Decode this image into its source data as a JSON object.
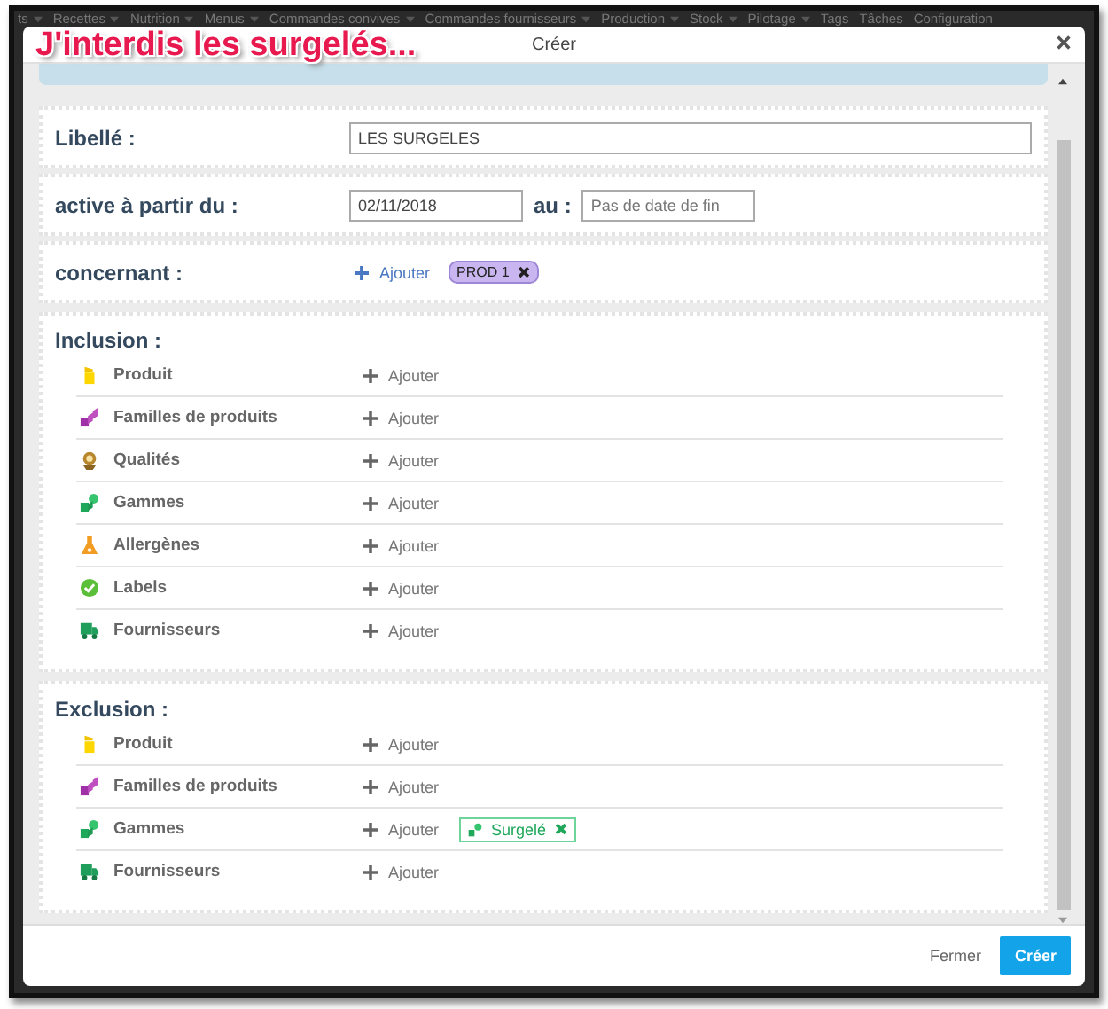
{
  "background_nav": [
    {
      "label": "ts",
      "caret": true
    },
    {
      "label": "Recettes",
      "caret": true
    },
    {
      "label": "Nutrition",
      "caret": true
    },
    {
      "label": "Menus",
      "caret": true
    },
    {
      "label": "Commandes convives",
      "caret": true
    },
    {
      "label": "Commandes fournisseurs",
      "caret": true
    },
    {
      "label": "Production",
      "caret": true
    },
    {
      "label": "Stock",
      "caret": true
    },
    {
      "label": "Pilotage",
      "caret": true
    },
    {
      "label": "Tags",
      "caret": false
    },
    {
      "label": "Tâches",
      "caret": false
    },
    {
      "label": "Configuration",
      "caret": false
    }
  ],
  "dialog": {
    "title": "Créer",
    "caption": "J'interdis les surgelés...",
    "libelle": {
      "label": "Libellé :",
      "value": "LES SURGELES"
    },
    "period": {
      "label": "active à partir du :",
      "start": "02/11/2018",
      "separator": "au :",
      "end_placeholder": "Pas de date de fin"
    },
    "concernant": {
      "label": "concernant :",
      "add": "Ajouter",
      "tags": [
        {
          "label": "PROD 1"
        }
      ]
    },
    "sections": [
      {
        "title": "Inclusion :",
        "rows": [
          {
            "kind": "produit",
            "label": "Produit",
            "add": "Ajouter"
          },
          {
            "kind": "familles",
            "label": "Familles de produits",
            "add": "Ajouter"
          },
          {
            "kind": "qualites",
            "label": "Qualités",
            "add": "Ajouter"
          },
          {
            "kind": "gammes",
            "label": "Gammes",
            "add": "Ajouter"
          },
          {
            "kind": "allergenes",
            "label": "Allergènes",
            "add": "Ajouter"
          },
          {
            "kind": "labels",
            "label": "Labels",
            "add": "Ajouter"
          },
          {
            "kind": "fournisseurs",
            "label": "Fournisseurs",
            "add": "Ajouter"
          }
        ]
      },
      {
        "title": "Exclusion :",
        "rows": [
          {
            "kind": "produit",
            "label": "Produit",
            "add": "Ajouter"
          },
          {
            "kind": "familles",
            "label": "Familles de produits",
            "add": "Ajouter"
          },
          {
            "kind": "gammes",
            "label": "Gammes",
            "add": "Ajouter",
            "tags": [
              {
                "label": "Surgelé"
              }
            ]
          },
          {
            "kind": "fournisseurs",
            "label": "Fournisseurs",
            "add": "Ajouter"
          }
        ]
      }
    ],
    "footer": {
      "close": "Fermer",
      "submit": "Créer"
    }
  }
}
